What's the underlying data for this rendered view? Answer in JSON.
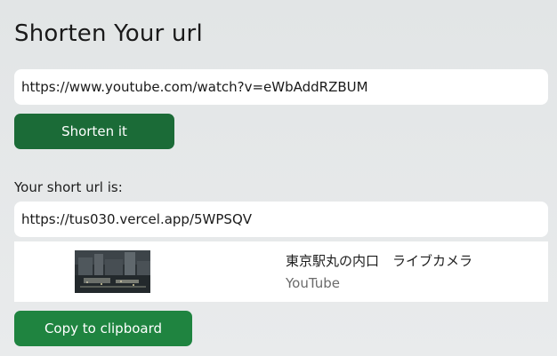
{
  "page": {
    "title": "Shorten Your url"
  },
  "form": {
    "url_value": "https://www.youtube.com/watch?v=eWbAddRZBUM",
    "shorten_label": "Shorten it"
  },
  "result": {
    "label": "Your short url is:",
    "short_url": "https://tus030.vercel.app/5WPSQV"
  },
  "preview": {
    "title": "東京駅丸の内口　ライブカメラ",
    "source": "YouTube"
  },
  "actions": {
    "copy_label": "Copy to clipboard"
  },
  "colors": {
    "shorten_button": "#1b6b37",
    "copy_button": "#1f8440",
    "background": "#e5e8e9"
  }
}
